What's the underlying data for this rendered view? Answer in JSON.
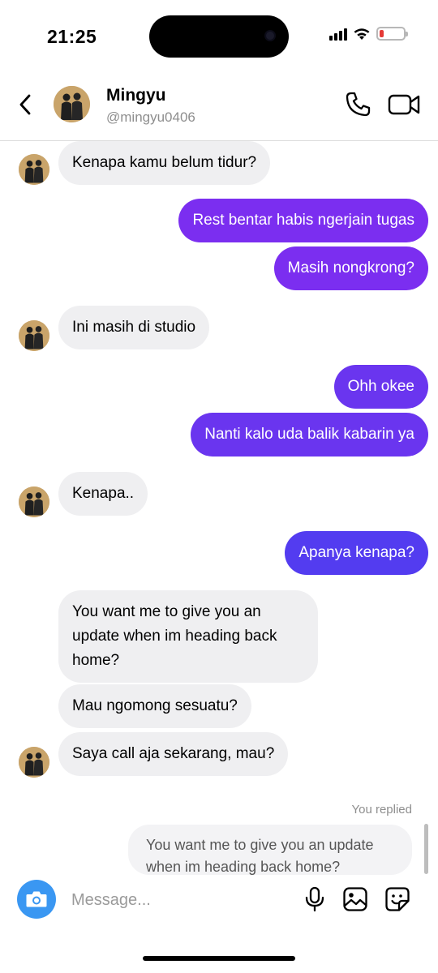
{
  "status_bar": {
    "time": "21:25"
  },
  "header": {
    "back_icon": "chevron-left-icon",
    "contact_name": "Mingyu",
    "contact_handle": "@mingyu0406",
    "call_icon": "phone-icon",
    "video_icon": "video-camera-icon"
  },
  "messages": [
    {
      "side": "in",
      "text": "Kenapa kamu belum tidur?"
    },
    {
      "side": "out",
      "text": "Rest bentar habis ngerjain tugas"
    },
    {
      "side": "out",
      "text": "Masih nongkrong?"
    },
    {
      "side": "in",
      "text": "Ini masih di studio"
    },
    {
      "side": "out",
      "text": "Ohh okee"
    },
    {
      "side": "out",
      "text": "Nanti kalo uda balik kabarin ya"
    },
    {
      "side": "in",
      "text": "Kenapa.."
    },
    {
      "side": "out",
      "text": "Apanya kenapa?"
    },
    {
      "side": "in",
      "text": "You want me to give you an update when im heading back home?"
    },
    {
      "side": "in",
      "text": "Mau ngomong sesuatu?"
    },
    {
      "side": "in",
      "text": "Saya call aja sekarang, mau?"
    }
  ],
  "reply": {
    "label": "You replied",
    "quoted_text": "You want me to give you an update when im heading back home?"
  },
  "composer": {
    "placeholder": "Message...",
    "camera_icon": "camera-icon",
    "mic_icon": "microphone-icon",
    "gallery_icon": "image-icon",
    "sticker_icon": "sticker-icon"
  },
  "colors": {
    "outgoing_purple": "#7b2ef0",
    "outgoing_indigo": "#533cf0",
    "incoming_bubble": "#efeff1",
    "camera_button": "#3a97f2"
  }
}
